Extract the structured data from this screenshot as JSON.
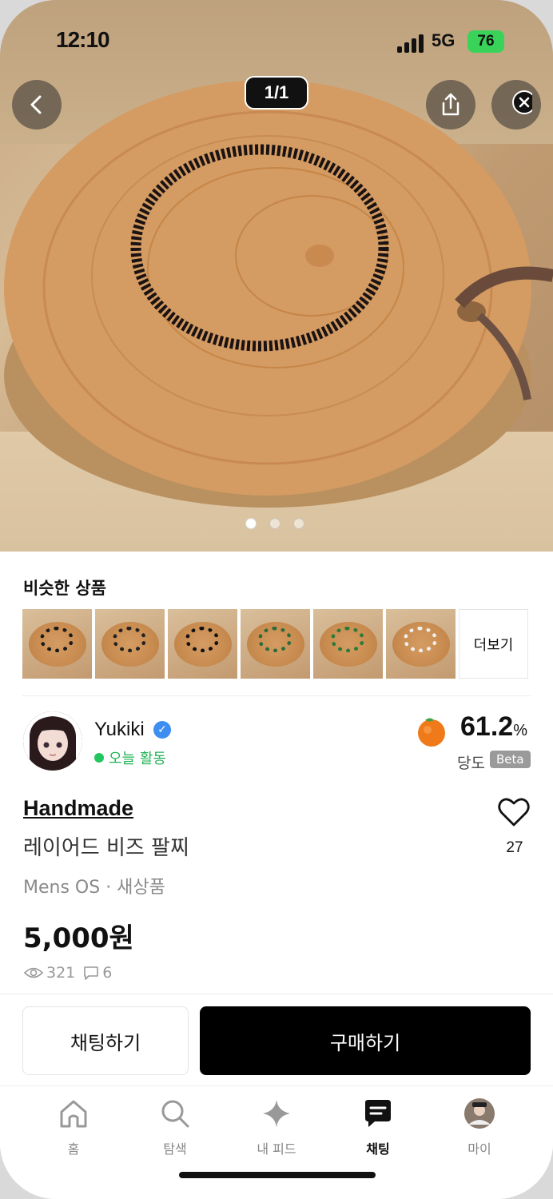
{
  "status_bar": {
    "time": "12:10",
    "network": "5G",
    "battery": "76"
  },
  "hero": {
    "page_indicator": "1/1",
    "dots": 3,
    "active_dot": 0
  },
  "similar": {
    "title": "비슷한 상품",
    "more_label": "더보기",
    "thumbs": [
      {
        "ring_color": "#1a1a1a"
      },
      {
        "ring_color": "#222222"
      },
      {
        "ring_color": "#111111"
      },
      {
        "ring_color": "#2f6b3a"
      },
      {
        "ring_color": "#2a7a3a"
      },
      {
        "ring_color": "#f0f0f0"
      }
    ]
  },
  "seller": {
    "name": "Yukiki",
    "activity": "오늘 활동",
    "sweetness_value": "61.2",
    "sweetness_unit": "%",
    "sweetness_label": "당도",
    "beta_badge": "Beta"
  },
  "product": {
    "brand": "Handmade",
    "name": "레이어드 비즈 팔찌",
    "meta": "Mens OS · 새상품",
    "price": "5,000원",
    "views": "321",
    "chats": "6",
    "likes": "27"
  },
  "actions": {
    "chat": "채팅하기",
    "buy": "구매하기"
  },
  "tabbar": {
    "items": [
      {
        "label": "홈",
        "icon": "home-icon"
      },
      {
        "label": "탐색",
        "icon": "search-icon"
      },
      {
        "label": "내 피드",
        "icon": "sparkle-icon"
      },
      {
        "label": "채팅",
        "icon": "chat-icon"
      },
      {
        "label": "마이",
        "icon": "profile-icon"
      }
    ],
    "active_index": 3
  },
  "colors": {
    "accent": "#000000",
    "online": "#22c55e",
    "verified": "#3d8ef0"
  }
}
